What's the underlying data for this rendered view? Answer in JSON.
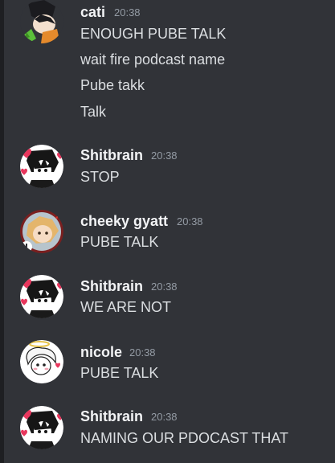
{
  "colors": {
    "background": "#313338",
    "sidebar_edge": "#1e1f22",
    "username": "#f2f3f5",
    "message_text": "#dbdee1",
    "timestamp": "#949ba4"
  },
  "messages": [
    {
      "author": "cati",
      "time": "20:38",
      "avatar_icon": "cati-avatar-icon",
      "lines": [
        "ENOUGH PUBE TALK",
        "wait fire podcast name",
        "Pube takk",
        "Talk"
      ]
    },
    {
      "author": "Shitbrain",
      "time": "20:38",
      "avatar_icon": "shitbrain-avatar-icon",
      "lines": [
        "STOP"
      ]
    },
    {
      "author": "cheeky gyatt",
      "time": "20:38",
      "avatar_icon": "cheeky-gyatt-avatar-icon",
      "lines": [
        "PUBE TALK"
      ]
    },
    {
      "author": "Shitbrain",
      "time": "20:38",
      "avatar_icon": "shitbrain-avatar-icon",
      "lines": [
        "WE ARE NOT"
      ]
    },
    {
      "author": "nicole",
      "time": "20:38",
      "avatar_icon": "nicole-avatar-icon",
      "lines": [
        "PUBE TALK"
      ]
    },
    {
      "author": "Shitbrain",
      "time": "20:38",
      "avatar_icon": "shitbrain-avatar-icon",
      "lines": [
        "NAMING OUR PDOCAST THAT"
      ]
    }
  ]
}
